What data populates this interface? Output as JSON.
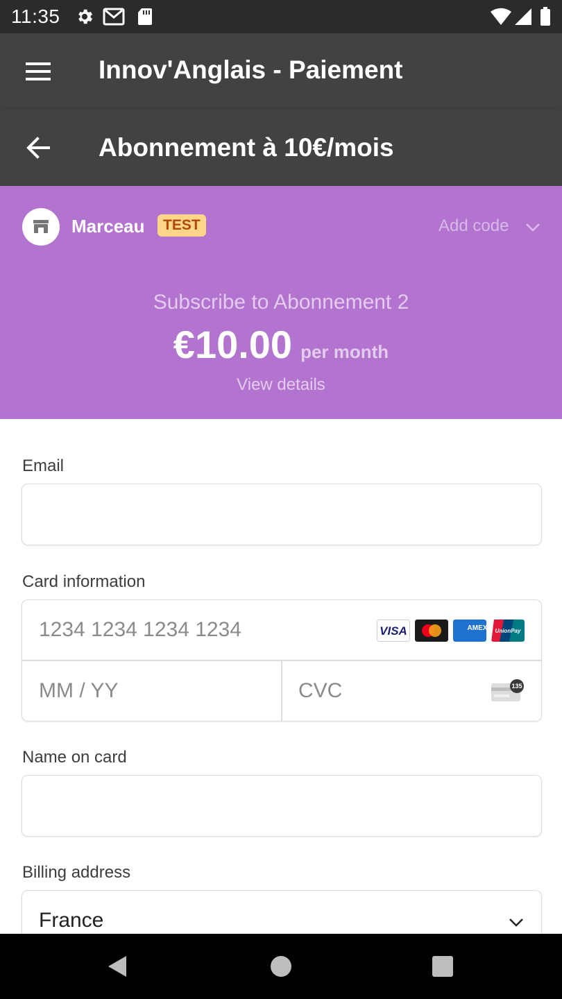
{
  "status_bar": {
    "time": "11:35"
  },
  "app_bar": {
    "title": "Innov'Anglais - Paiement"
  },
  "sub_bar": {
    "title": "Abonnement à 10€/mois"
  },
  "checkout": {
    "merchant_name": "Marceau",
    "test_badge": "TEST",
    "add_code": "Add code",
    "subscribe_title": "Subscribe to Abonnement 2",
    "price": "€10.00",
    "period": "per month",
    "view_details": "View details",
    "accent_color": "#b274cf"
  },
  "form": {
    "email_label": "Email",
    "email_value": "",
    "card_label": "Card information",
    "card_number_placeholder": "1234 1234 1234 1234",
    "expiry_placeholder": "MM / YY",
    "cvc_placeholder": "CVC",
    "cvc_hint": "135",
    "card_brands": [
      "VISA",
      "mastercard",
      "AMEX",
      "UnionPay"
    ],
    "name_label": "Name on card",
    "name_value": "",
    "billing_label": "Billing address",
    "country_value": "France"
  }
}
